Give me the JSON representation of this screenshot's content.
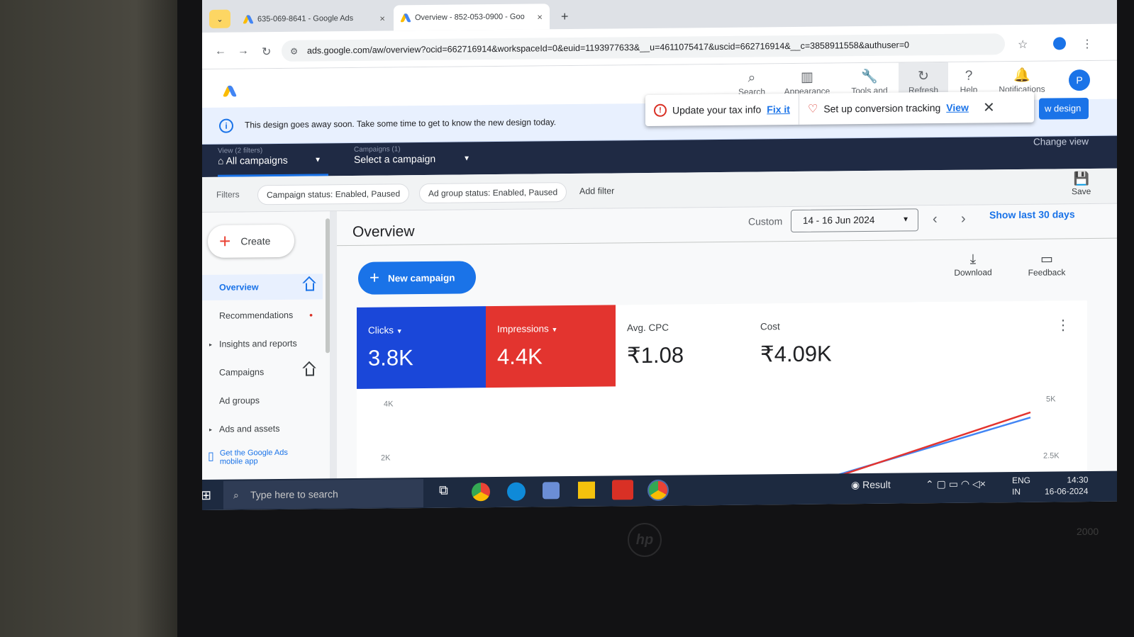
{
  "browser": {
    "tabs": [
      {
        "title": "635-069-8641 - Google Ads"
      },
      {
        "title": "Overview - 852-053-0900 - Goo"
      }
    ],
    "url": "ads.google.com/aw/overview?ocid=662716914&workspaceId=0&euid=1193977633&__u=4611075417&uscid=662716914&__c=3858911558&authuser=0"
  },
  "header": {
    "buttons": [
      {
        "label": "Search",
        "icon": "search-icon"
      },
      {
        "label": "Appearance",
        "icon": "appearance-icon"
      },
      {
        "label": "Tools and settings",
        "icon": "wrench-icon"
      },
      {
        "label": "Refresh",
        "icon": "refresh-icon"
      },
      {
        "label": "Help",
        "icon": "help-icon"
      },
      {
        "label": "Notifications",
        "icon": "bell-icon"
      }
    ],
    "avatar": "P"
  },
  "infobar": {
    "text": "This design goes away soon. Take some time to get to know the new design today.",
    "new_design_button": "w design"
  },
  "popover": {
    "tax": "Update your tax info",
    "tax_link": "Fix it",
    "conversion": "Set up conversion tracking",
    "conversion_link": "View"
  },
  "selectors": {
    "view_caption": "View (2 filters)",
    "view_value": "All campaigns",
    "campaign_caption": "Campaigns (1)",
    "campaign_value": "Select a campaign",
    "change_view": "Change view"
  },
  "filters": {
    "label": "Filters",
    "chips": [
      "Campaign status: Enabled, Paused",
      "Ad group status: Enabled, Paused"
    ],
    "add": "Add filter",
    "save": "Save"
  },
  "sidebar": {
    "create": "Create",
    "items": [
      {
        "label": "Overview"
      },
      {
        "label": "Recommendations"
      },
      {
        "label": "Insights and reports"
      },
      {
        "label": "Campaigns"
      },
      {
        "label": "Ad groups"
      },
      {
        "label": "Ads and assets"
      }
    ],
    "app_promo": "Get the Google Ads mobile app"
  },
  "overview": {
    "title": "Overview",
    "range_label": "Custom",
    "date_range": "14 - 16 Jun 2024",
    "show_last": "Show last 30 days",
    "new_campaign": "New campaign",
    "download": "Download",
    "feedback": "Feedback"
  },
  "metrics": [
    {
      "label": "Clicks",
      "value": "3.8K",
      "color": "#1a47d9"
    },
    {
      "label": "Impressions",
      "value": "4.4K",
      "color": "#e3342f"
    },
    {
      "label": "Avg. CPC",
      "value": "₹1.08"
    },
    {
      "label": "Cost",
      "value": "₹4.09K"
    }
  ],
  "chart_data": {
    "type": "line",
    "left_ticks": [
      "4K",
      "2K"
    ],
    "right_ticks": [
      "5K",
      "2.5K"
    ],
    "series": [
      {
        "color": "#4285f4",
        "values": [
          0,
          3800
        ]
      },
      {
        "color": "#e3342f",
        "values": [
          0,
          4400
        ]
      }
    ]
  },
  "taskbar": {
    "search_placeholder": "Type here to search",
    "result": "Result",
    "lang1": "ENG",
    "lang2": "IN",
    "time": "14:30",
    "date": "16-06-2024"
  },
  "monitor": {
    "brand": "hp",
    "model": "2000"
  }
}
